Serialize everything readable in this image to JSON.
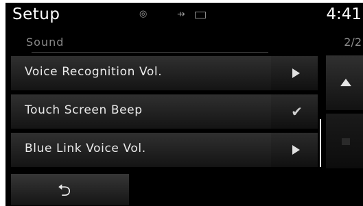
{
  "header": {
    "title": "Setup",
    "time": "4:41"
  },
  "status_icons": [
    "bluetooth-icon",
    "usb-icon",
    "battery-icon"
  ],
  "subheader": {
    "title": "Sound",
    "page": "2/2"
  },
  "items": [
    {
      "label": "Voice Recognition Vol.",
      "accessory": "arrow"
    },
    {
      "label": "Touch Screen Beep",
      "accessory": "check"
    },
    {
      "label": "Blue Link Voice Vol.",
      "accessory": "arrow"
    }
  ],
  "colors": {
    "background": "#000000",
    "text": "#eaeaea",
    "dim_text": "#8a8a8a"
  }
}
